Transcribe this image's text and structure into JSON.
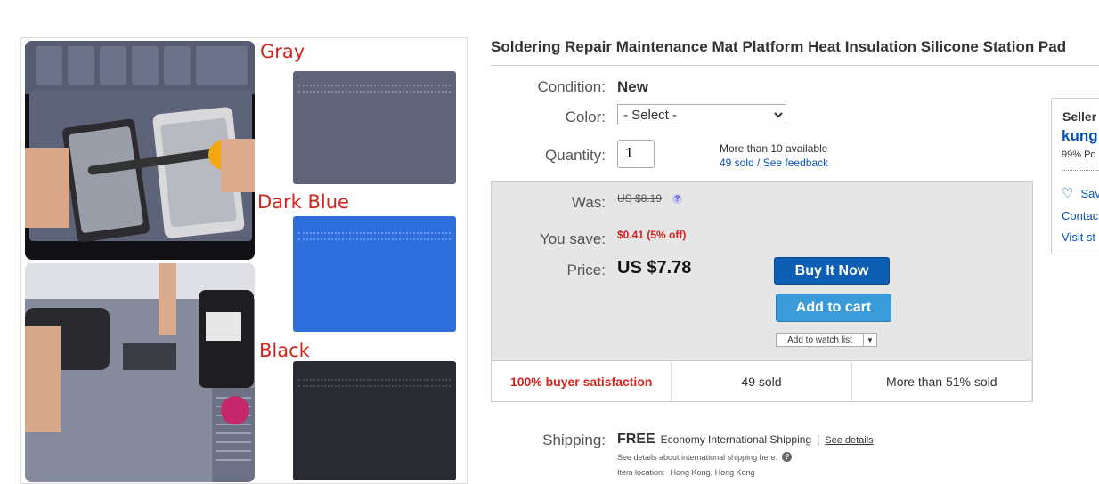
{
  "listing": {
    "title": "Soldering Repair Maintenance Mat Platform Heat Insulation Silicone Station Pad",
    "images": {
      "swatches": [
        {
          "label": "Gray",
          "color": "#5f6478"
        },
        {
          "label": "Dark Blue",
          "color": "#2f6fdc"
        },
        {
          "label": "Black",
          "color": "#2a2a33"
        }
      ]
    },
    "condition": {
      "label": "Condition:",
      "value": "New"
    },
    "color": {
      "label": "Color:",
      "selected": "- Select -"
    },
    "quantity": {
      "label": "Quantity:",
      "value": "1",
      "available": "More than 10 available",
      "sold_link": "49 sold",
      "separator": "/",
      "feedback_link": "See feedback"
    },
    "price": {
      "was_label": "Was:",
      "was_value": "US $8.19",
      "save_label": "You save:",
      "save_value": "$0.41 (5% off)",
      "price_label": "Price:",
      "price_value": "US $7.78",
      "help_icon": "question-icon"
    },
    "actions": {
      "buy_now": "Buy It Now",
      "add_to_cart": "Add to cart",
      "watch": "Add to watch list"
    },
    "stats": {
      "satisfaction": "100% buyer satisfaction",
      "sold": "49 sold",
      "percent_sold": "More than 51% sold"
    },
    "shipping": {
      "label": "Shipping:",
      "free": "FREE",
      "method": "Economy International Shipping",
      "sep": "|",
      "details_link": "See details",
      "note": "See details about international shipping here.",
      "location_label": "Item location:",
      "location": "Hong Kong, Hong Kong"
    }
  },
  "seller_card": {
    "heading": "Seller",
    "name": "kung",
    "feedback": "99% Po",
    "save": "Sav",
    "contact": "Contact",
    "visit": "Visit st"
  },
  "colors": {
    "accent_red": "#d2231c",
    "link_blue": "#0654ba",
    "buy_now_bg": "#0e5fb3",
    "add_cart_bg": "#3b9bd8"
  }
}
